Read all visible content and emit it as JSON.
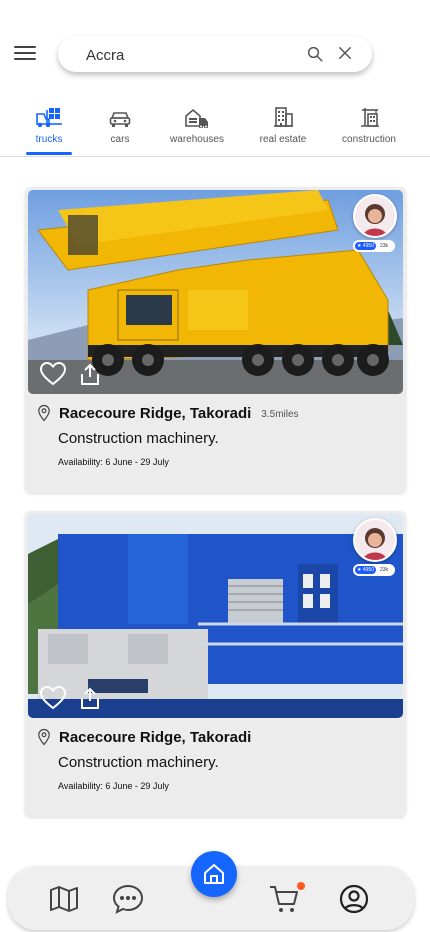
{
  "search": {
    "value": "Accra",
    "placeholder": ""
  },
  "tabs": [
    {
      "label": "trucks",
      "icon": "forklift-icon",
      "active": true
    },
    {
      "label": "cars",
      "icon": "car-icon",
      "active": false
    },
    {
      "label": "warehouses",
      "icon": "warehouse-icon",
      "active": false
    },
    {
      "label": "real estate",
      "icon": "building-icon",
      "active": false
    },
    {
      "label": "construction",
      "icon": "construction-icon",
      "active": false
    }
  ],
  "listings": [
    {
      "location": "Racecoure Ridge, Takoradi",
      "distance": "3.5miles",
      "description": "Construction machinery.",
      "availability": "Availability: 6 June - 29 July",
      "rating_badge": "★ 4950",
      "rating_count": "23k",
      "image": "yellow-crane-truck"
    },
    {
      "location": "Racecoure Ridge, Takoradi",
      "distance": "",
      "description": "Construction machinery.",
      "availability": "Availability: 6 June - 29 July",
      "rating_badge": "★ 4950",
      "rating_count": "23k",
      "image": "blue-crawler-crane"
    }
  ],
  "bottom_nav": [
    {
      "icon": "map-icon"
    },
    {
      "icon": "chat-icon"
    },
    {
      "icon": "home-icon"
    },
    {
      "icon": "cart-icon"
    },
    {
      "icon": "profile-icon"
    }
  ],
  "colors": {
    "accent": "#1565ff",
    "notification": "#ff5a1f"
  }
}
